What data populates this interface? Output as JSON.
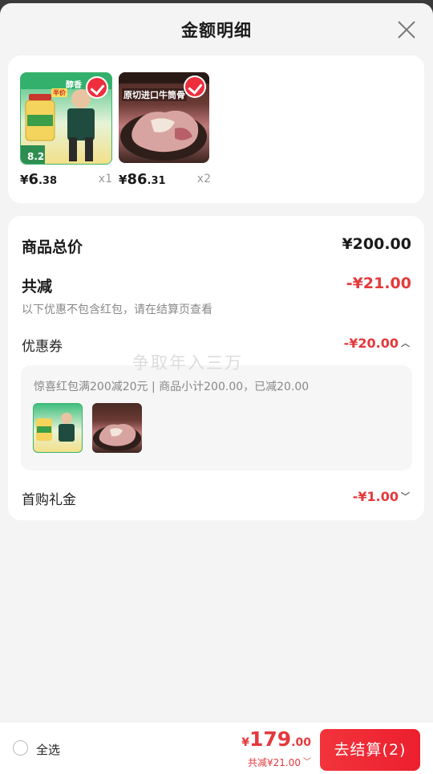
{
  "header": {
    "title": "金额明细",
    "close_icon": "close-icon"
  },
  "products": [
    {
      "image_text": [
        "醇香",
        "半价",
        "8.2"
      ],
      "price_currency": "¥",
      "price_int": "6",
      "price_dec": ".38",
      "quantity": "x1"
    },
    {
      "image_text": [
        "原切进口牛筒骨"
      ],
      "price_currency": "¥",
      "price_int": "86",
      "price_dec": ".31",
      "quantity": "x2"
    }
  ],
  "summary": {
    "total_label": "商品总价",
    "total_value": "¥200.00",
    "reduce_label": "共减",
    "reduce_value": "-¥21.00",
    "reduce_note": "以下优惠不包含红包，请在结算页查看",
    "coupon_label": "优惠券",
    "coupon_value": "-¥20.00",
    "coupon_desc": "惊喜红包满200减20元 | 商品小计200.00，已减20.00",
    "gift_label": "首购礼金",
    "gift_value": "-¥1.00"
  },
  "watermark": "争取年入三万",
  "bottom_bar": {
    "select_all": "全选",
    "total_currency": "¥",
    "total_int": "179",
    "total_dec": ".00",
    "discount": "共减¥21.00",
    "checkout": "去结算(2)"
  },
  "colors": {
    "accent": "#e4393c",
    "background": "#f4f4f4"
  }
}
